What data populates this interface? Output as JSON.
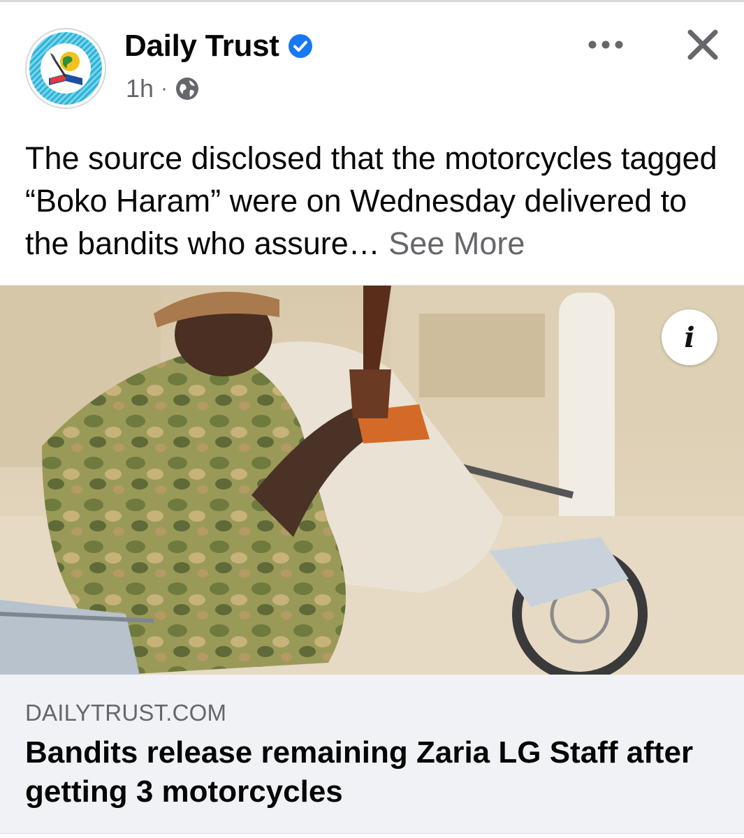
{
  "post": {
    "page_name": "Daily Trust",
    "timestamp": "1h",
    "separator": "·",
    "text": "The source disclosed that the motorcycles tagged “Boko Haram” were on Wednesday delivered to the bandits who assure…",
    "see_more_label": "See More"
  },
  "header_actions": {
    "more_icon": "more-horizontal-icon",
    "close_icon": "close-icon"
  },
  "link_preview": {
    "image_description_icon": "info-icon",
    "info_label": "i",
    "domain": "DAILYTRUST.COM",
    "title": "Bandits release remaining Zaria LG Staff after getting 3 motorcycles"
  },
  "colors": {
    "verified_blue": "#1877f2",
    "secondary_text": "#65676b",
    "footer_bg": "#f0f2f5"
  }
}
